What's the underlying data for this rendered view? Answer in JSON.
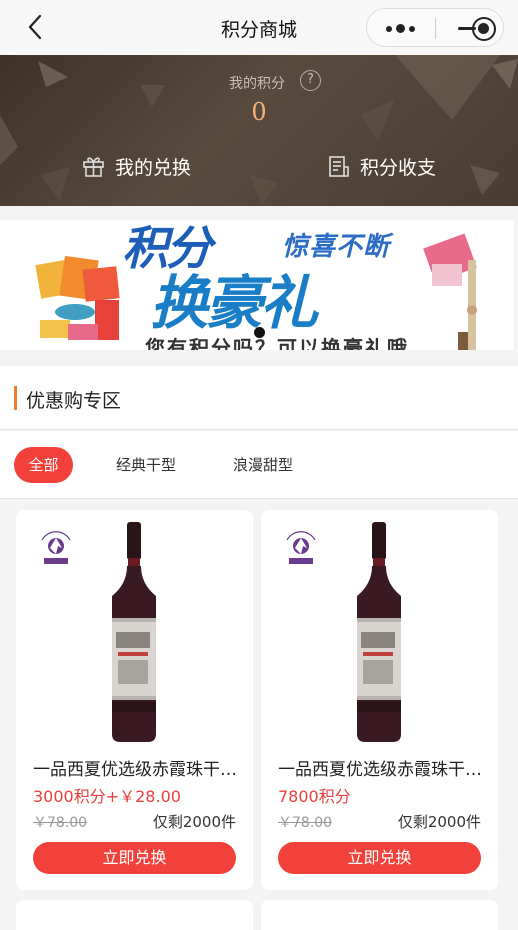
{
  "nav": {
    "title": "积分商城"
  },
  "header": {
    "points_label": "我的积分",
    "points_help_icon": "?",
    "points_value": "0",
    "my_exchange": "我的兑换",
    "points_ledger": "积分收支"
  },
  "banner": {
    "headline_top": "积分",
    "headline_tag": "惊喜不断",
    "headline_bottom": "换豪礼",
    "slogan": "您有积分吗？可以换豪礼哦",
    "pager_active": 1,
    "pager_total": 1
  },
  "section": {
    "title": "优惠购专区"
  },
  "tabs": [
    {
      "label": "全部",
      "active": true
    },
    {
      "label": "经典干型",
      "active": false
    },
    {
      "label": "浪漫甜型",
      "active": false
    }
  ],
  "products": [
    {
      "name": "一品西夏优选级赤霞珠干红葡萄酒",
      "price": "3000积分+￥28.00",
      "original_price": "￥78.00",
      "stock": "仅剩2000件",
      "button": "立即兑换"
    },
    {
      "name": "一品西夏优选级赤霞珠干红葡萄酒",
      "price": "7800积分",
      "original_price": "￥78.00",
      "stock": "仅剩2000件",
      "button": "立即兑换"
    }
  ],
  "colors": {
    "accent": "#f2403b",
    "section_bar": "#f07a2e",
    "points_value": "#f3b37a",
    "header_bg": "#4a3c31"
  }
}
